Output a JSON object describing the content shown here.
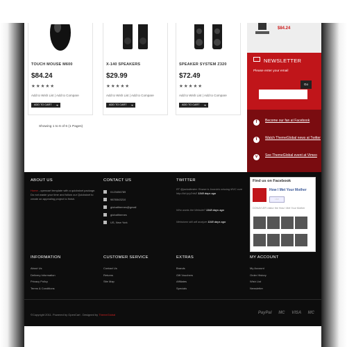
{
  "products": [
    {
      "name": "TOUCH MOUSE M600",
      "price": "$84.24",
      "stars": "★★★★★",
      "wishlist": "Add to Wish List",
      "compare": "Add to Compare",
      "cart": "ADD TO CART"
    },
    {
      "name": "X-140 SPEAKERS",
      "price": "$29.99",
      "stars": "★★★★★",
      "wishlist": "Add to Wish List",
      "compare": "Add to Compare",
      "cart": "ADD TO CART"
    },
    {
      "name": "SPEAKER SYSTEM Z320",
      "price": "$72.49",
      "stars": "★★★★★",
      "wishlist": "Add to Wish List",
      "compare": "Add to Compare",
      "cart": "ADD TO CART"
    }
  ],
  "showing": "Showing 1 to 6 of 6 (1 Pages)",
  "sidebar": {
    "top_price": "$84.24",
    "newsletter": {
      "title": "NEWSLETTER",
      "label": "Please enter your email",
      "go": "Go"
    },
    "social": [
      {
        "icon": "f",
        "text": "Become our fan at Facebook"
      },
      {
        "icon": "t",
        "text": "Watch ThemeGlobal news at Twitter"
      },
      {
        "icon": "v",
        "text": "See ThemeGlobal event at Vimeo"
      }
    ]
  },
  "footer": {
    "about": {
      "title": "ABOUT US",
      "brand": "Home",
      "text": " - opencart template with a quickstart package. Do not waste your time and follow our Quickstart to create an appealing project to finish."
    },
    "contact": {
      "title": "CONTACT US",
      "items": [
        "0123456789",
        "9876543210",
        "globalthemes@gmail",
        "globalthemes",
        "US, New York"
      ]
    },
    "twitter": {
      "title": "TWITTER",
      "tweets": [
        {
          "text": "RT @jackallenlee: Rowse is Joomla's missing MVC core http://bit.ly/yZnfsE",
          "time": "1348 days ago"
        },
        {
          "text": "Who wants the Website?",
          "time": "1348 days ago"
        },
        {
          "text": "Webstorm still will analyze",
          "time": "1348 days ago"
        }
      ]
    },
    "facebook": {
      "title": "Find us on Facebook",
      "page": "How I Met Your Mother",
      "like": "Like",
      "desc": "DONAYLER visitor the How I Met Your Mother"
    },
    "columns": [
      {
        "title": "INFORMATION",
        "links": [
          "About Us",
          "Delivery Information",
          "Privacy Policy",
          "Terms & Conditions"
        ]
      },
      {
        "title": "CUSTOMER SERVICE",
        "links": [
          "Contact Us",
          "Returns",
          "Site Map"
        ]
      },
      {
        "title": "EXTRAS",
        "links": [
          "Brands",
          "Gift Vouchers",
          "Affiliates",
          "Specials"
        ]
      },
      {
        "title": "MY ACCOUNT",
        "links": [
          "My Account",
          "Order History",
          "Wish List",
          "Newsletter"
        ]
      }
    ],
    "copyright": "©Copyright 2011. Powered by OpenCart . Designed by ",
    "designer": "ThemeGlobal",
    "payments": [
      "PayPal",
      "MC",
      "VISA",
      "MC"
    ]
  }
}
